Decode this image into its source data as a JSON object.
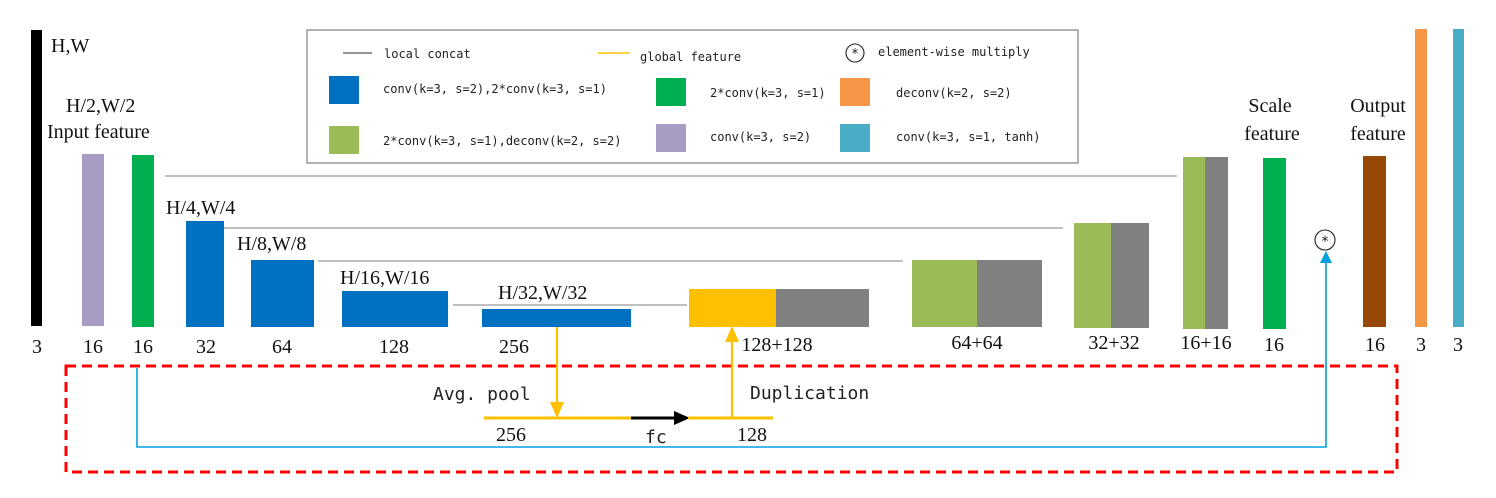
{
  "colors": {
    "blue": "#0070C0",
    "green": "#00B050",
    "lightgreen": "#9BBB59",
    "purple": "#A89CC3",
    "orange": "#F79646",
    "teal": "#4BACC6",
    "brown": "#974706",
    "gold": "#FFC000",
    "gray": "#808080",
    "black": "#000000",
    "red_dash": "#FF0000",
    "skip_blue": "#00A0E0",
    "line_gray": "#7F7F7F"
  },
  "legend": {
    "local_concat": "local concat",
    "global_feature": "global feature",
    "multiply_symbol": "⊛",
    "element_wise_multiply": "element-wise multiply",
    "blue_op": "conv(k=3, s=2),2*conv(k=3, s=1)",
    "green_op": "2*conv(k=3, s=1)",
    "orange_op": "deconv(k=2, s=2)",
    "lightgreen_op": "2*conv(k=3, s=1),deconv(k=2, s=2)",
    "purple_op": "conv(k=3, s=2)",
    "teal_op": "conv(k=3, s=1, tanh)"
  },
  "labels": {
    "hw": "H,W",
    "h2w2": "H/2,W/2",
    "input_feature": "Input feature",
    "h4w4": "H/4,W/4",
    "h8w8": "H/8,W/8",
    "h16w16": "H/16,W/16",
    "h32w32": "H/32,W/32",
    "scale_feature_1": "Scale",
    "scale_feature_2": "feature",
    "output_feature_1": "Output",
    "output_feature_2": "feature",
    "avg_pool": "Avg. pool",
    "duplication": "Duplication",
    "fc": "fc",
    "global_256": "256",
    "global_128": "128",
    "multiply": "⊛"
  },
  "channels": {
    "input_img": "3",
    "purple": "16",
    "green_in": "16",
    "blue32": "32",
    "blue64": "64",
    "blue128": "128",
    "blue256": "256",
    "dec128": "128+128",
    "dec64": "64+64",
    "dec32": "32+32",
    "dec16": "16+16",
    "scale": "16",
    "output": "16",
    "orange_out": "3",
    "teal_out": "3"
  }
}
